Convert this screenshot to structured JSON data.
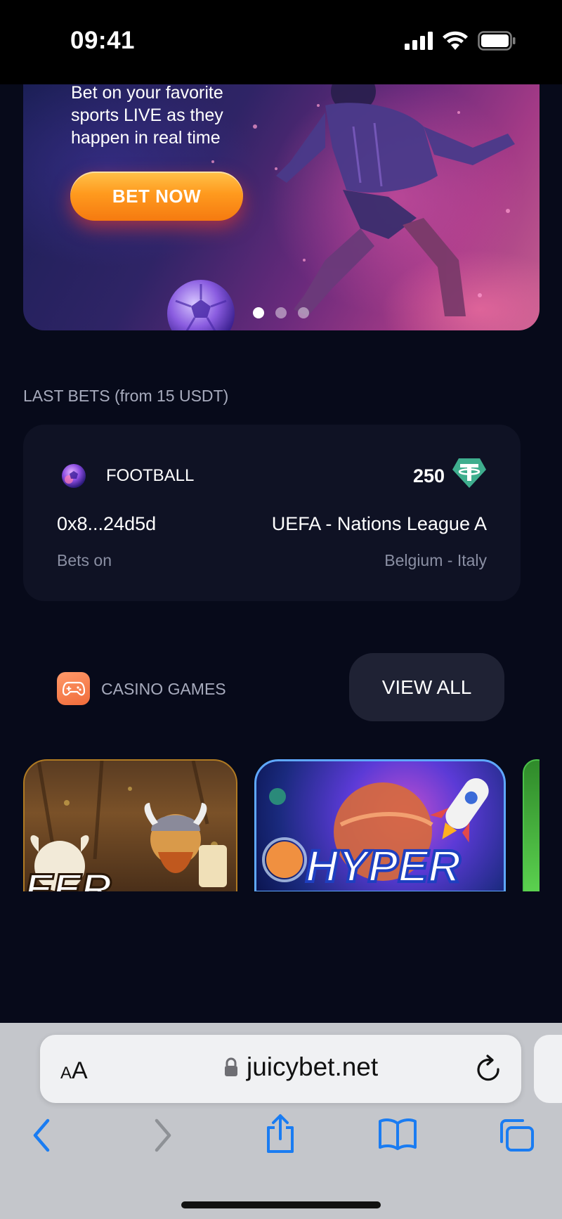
{
  "status_bar": {
    "time": "09:41"
  },
  "hero": {
    "tagline_lines": [
      "Bet on your favorite",
      "sports LIVE as they",
      "happen in real time"
    ],
    "cta_label": "BET NOW",
    "slides": 3,
    "active_slide": 1
  },
  "last_bets": {
    "label": "LAST BETS (from 15 USDT)",
    "items": [
      {
        "sport": "FOOTBALL",
        "amount": "250",
        "currency_icon": "tether-icon",
        "user": "0x8...24d5d",
        "event": "UEFA - Nations League A",
        "bets_on_label": "Bets on",
        "match": "Belgium - Italy"
      }
    ]
  },
  "casino": {
    "label": "CASINO GAMES",
    "view_all_label": "VIEW ALL",
    "games": [
      {
        "title_fragment": "EER",
        "icon": "viking-game-thumbnail"
      },
      {
        "title_fragment": "HYPER",
        "icon": "space-game-thumbnail"
      },
      {
        "title_fragment": "",
        "icon": "green-game-thumbnail"
      }
    ]
  },
  "browser": {
    "text_size_label_small": "A",
    "text_size_label_big": "A",
    "url": "juicybet.net"
  },
  "colors": {
    "background": "#070a1a",
    "card": "#0f1224",
    "cta_orange": "#ff9a1e",
    "tether_green": "#3fae8e",
    "safari_blue": "#1a7cf2"
  }
}
